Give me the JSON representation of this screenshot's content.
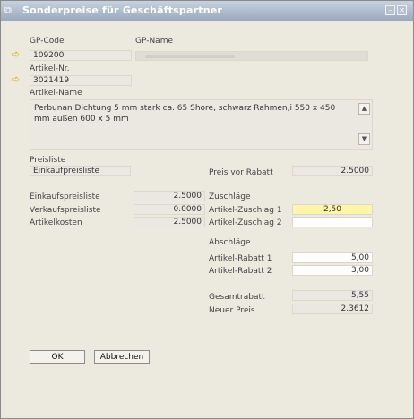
{
  "window": {
    "title": "Sonderpreise für Geschäftspartner"
  },
  "header": {
    "gp_code_label": "GP-Code",
    "gp_code_value": "109200",
    "gp_name_label": "GP-Name",
    "artikel_nr_label": "Artikel-Nr.",
    "artikel_nr_value": "3021419",
    "artikel_name_label": "Artikel-Name",
    "artikel_name_value": "Perbunan Dichtung 5 mm stark ca. 65 Shore, schwarz Rahmen,i 550 x 450 mm außen 600 x 5 mm"
  },
  "preisliste": {
    "label": "Preisliste",
    "value": "Einkaufpreisliste"
  },
  "preis_vor_rabatt": {
    "label": "Preis vor Rabatt",
    "value": "2.5000"
  },
  "left_prices": [
    {
      "label": "Einkaufspreisliste",
      "value": "2.5000"
    },
    {
      "label": "Verkaufspreisliste",
      "value": "0.0000"
    },
    {
      "label": "Artikelkosten",
      "value": "2.5000"
    }
  ],
  "zuschlaege": {
    "heading": "Zuschläge",
    "items": [
      {
        "label": "Artikel-Zuschlag 1",
        "value": "2,50"
      },
      {
        "label": "Artikel-Zuschlag 2",
        "value": ""
      }
    ]
  },
  "abschlaege": {
    "heading": "Abschläge",
    "items": [
      {
        "label": "Artikel-Rabatt 1",
        "value": "5,00"
      },
      {
        "label": "Artikel-Rabatt 2",
        "value": "3,00"
      }
    ]
  },
  "totals": {
    "gesamtrabatt_label": "Gesamtrabatt",
    "gesamtrabatt_value": "5,55",
    "neuer_preis_label": "Neuer Preis",
    "neuer_preis_value": "2.3612"
  },
  "buttons": {
    "ok": "OK",
    "cancel": "Abbrechen"
  },
  "colors": {
    "title_bar": "#9aa9bc",
    "highlight_field": "#fff5a8",
    "link_arrow": "#d6a100"
  }
}
